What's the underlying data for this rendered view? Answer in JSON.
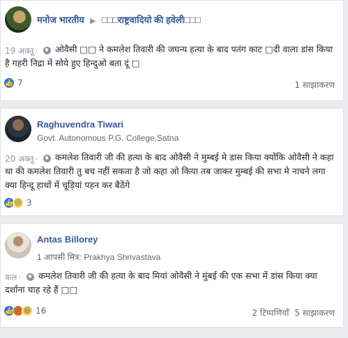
{
  "posts": [
    {
      "author": "मनोज भारतीय",
      "group": "□□□राष्ट्रवादियो की हवेली□□□",
      "time": "19 अक्तू",
      "text": "ओवैसी □□ ने कमलेश तिवारी की जघन्य हत्या के बाद पतंग काट □दी वाला डांस किया है गहरी निद्रा में सोये हुए हिन्दुओ बता दूं □",
      "reaction_count": "7",
      "shares": "1 साझाकरण"
    },
    {
      "author": "Raghuvendra Tiwari",
      "subtitle": "Govt. Autonomous P.G. College,Satna",
      "time": "20 अक्तू",
      "text": "कमलेश तिवारी जी की हत्या के बाद ओवैसी ने मुम्बई मे डास किया क्योंकि ओवैसी ने कहा था की कमलेश तिवारी तु बच नहीं सकता है जो कहा ओ किया तब जाकर मुम्बई की सभा मे नाचने लगा क्या हिन्दू हाथों में चूड़ियां पहन कर बैठेंगे",
      "reaction_count": "3"
    },
    {
      "author": "Antas Billorey",
      "subtitle": "1 आपसी मित्र: Prakhya Shrivastava",
      "time": "कल",
      "text": "कमलेश तिवारी जी की हत्या के बाद मियां ओवैसी ने मुंबई की एक सभा में डांस किया क्या दर्शाना चाह रहे हैं □□",
      "reaction_count": "16",
      "comments": "2 टिप्पणियाँ",
      "shares": "5 साझाकरण"
    }
  ],
  "icons": {
    "globe": "globe-icon",
    "like": "like-reaction-icon",
    "sad": "sad-reaction-icon",
    "angry": "angry-reaction-icon",
    "haha": "haha-reaction-icon",
    "arrow": "right-arrow-icon"
  },
  "colors": {
    "link": "#365899",
    "meta": "#90949c",
    "like": "#2078f4",
    "background": "#e9ebee"
  }
}
